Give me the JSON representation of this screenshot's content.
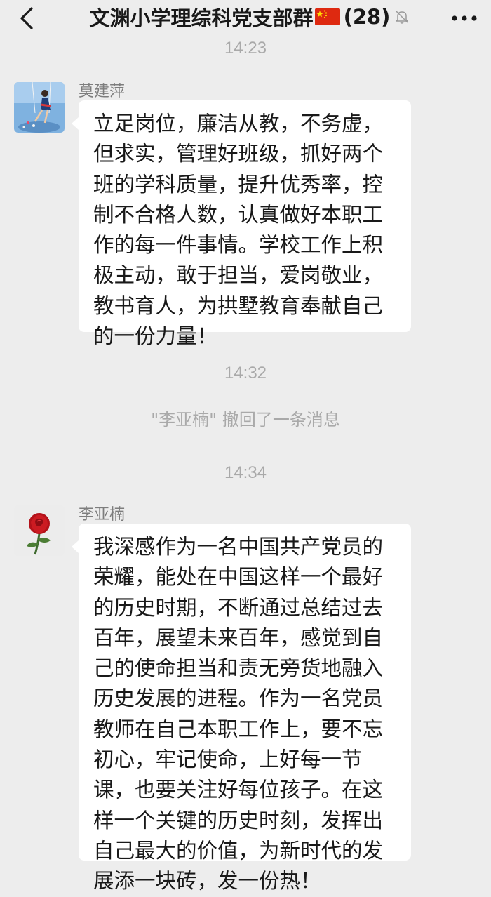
{
  "header": {
    "back_icon": "chevron-left-icon",
    "group_name": "文渊小学理综科党支部群",
    "flag_icon": "china-flag-icon",
    "member_count": "(28)",
    "mute_icon": "bell-muted-icon",
    "more_icon": "more-dots-icon"
  },
  "timestamps": [
    "14:23",
    "14:32",
    "14:34"
  ],
  "system_message": "\"李亚楠\" 撤回了一条消息",
  "messages": [
    {
      "sender": "莫建萍",
      "avatar": "girl-on-swing-avatar",
      "lines": [
        "立足岗位，廉洁从教，不务虚，",
        "但求实，管理好班级，抓好两个",
        "班的学科质量，提升优秀率，控",
        "制不合格人数，认真做好本职工",
        "作的每一件事情。学校工作上积",
        "极主动，敢于担当，爱岗敬业，",
        "教书育人，为拱墅教育奉献自己",
        "的一份力量！"
      ]
    },
    {
      "sender": "李亚楠",
      "avatar": "red-rose-avatar",
      "lines": [
        "我深感作为一名中国共产党员的",
        "荣耀，能处在中国这样一个最好",
        "的历史时期，不断通过总结过去",
        "百年，展望未来百年，感觉到自",
        "己的使命担当和责无旁货地融入",
        "历史发展的进程。作为一名党员",
        "教师在自己本职工作上，要不忘",
        "初心，牢记使命，上好每一节",
        "课，也要关注好每位孩子。在这",
        "样一个关键的历史时刻，发挥出",
        "自己最大的价值，为新时代的发",
        "展添一块砖，发一份热！"
      ]
    }
  ]
}
